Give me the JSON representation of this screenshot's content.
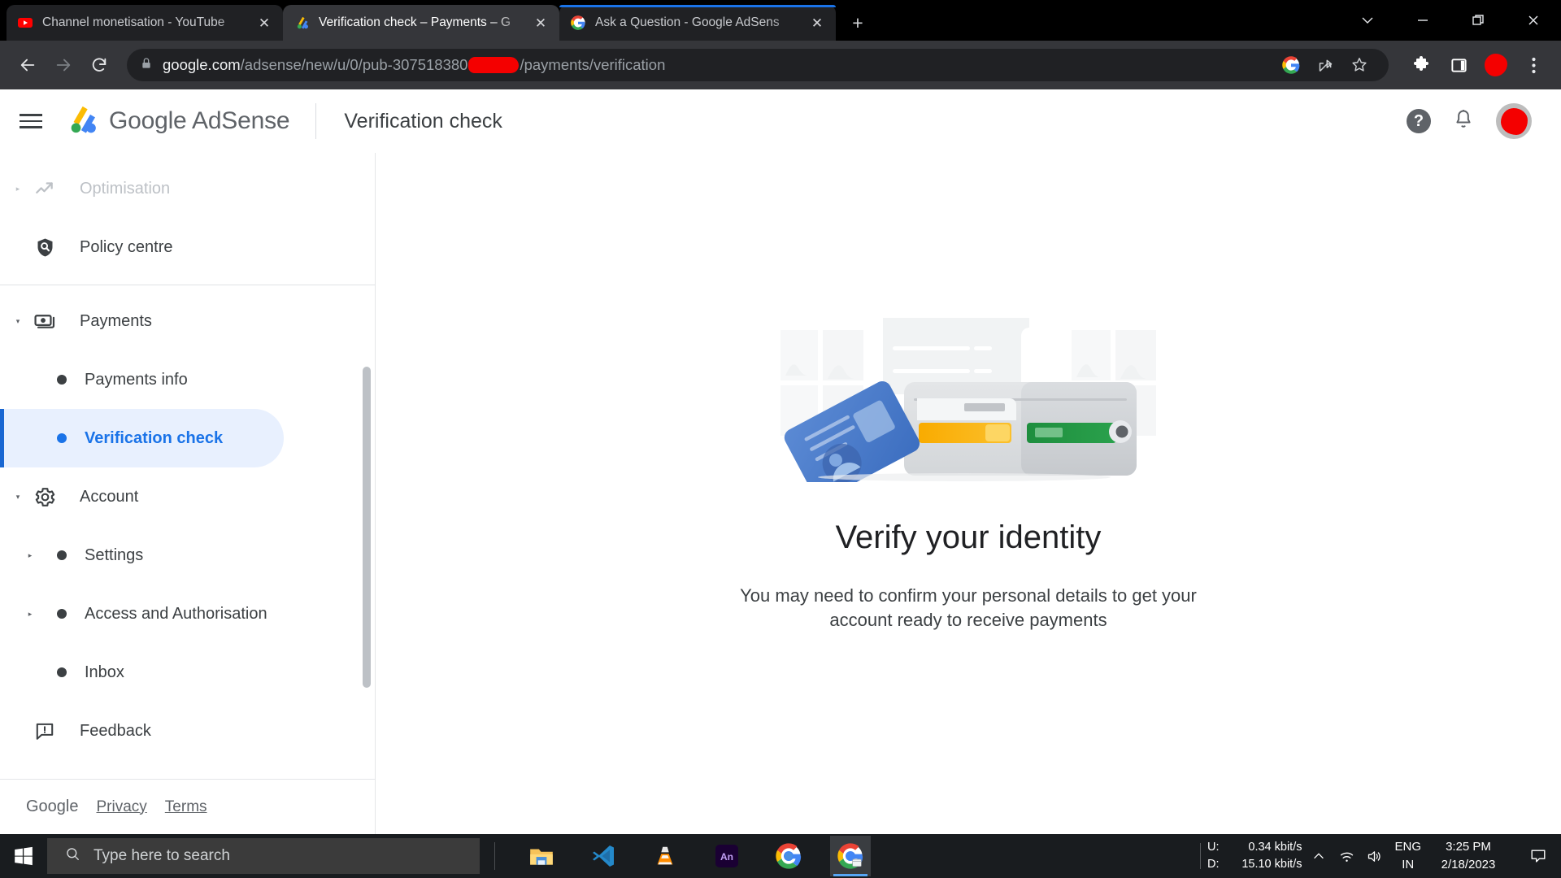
{
  "browser": {
    "tabs": [
      {
        "title": "Channel monetisation - YouTube",
        "favicon": "youtube-icon",
        "active": false,
        "close_label": "✕"
      },
      {
        "title": "Verification check – Payments – G",
        "favicon": "adsense-icon",
        "active": true,
        "close_label": "✕"
      },
      {
        "title": "Ask a Question - Google AdSens",
        "favicon": "google-icon",
        "active": false,
        "close_label": "✕"
      }
    ],
    "new_tab_label": "+",
    "window_controls": {
      "tab_search": "⌄",
      "minimize": "—",
      "maximize": "❐",
      "close": "✕"
    },
    "omnibox": {
      "lock_icon": "lock-icon",
      "url_host": "google.com",
      "url_path_before": "/adsense/new/u/0/pub-307518380",
      "url_redacted": true,
      "url_path_after": "/payments/verification"
    },
    "toolbar_icons": [
      "google-icon",
      "share-icon",
      "bookmark-star-icon",
      "extensions-puzzle-icon",
      "side-panel-icon",
      "profile-avatar-icon",
      "three-dot-menu-icon"
    ]
  },
  "adsense": {
    "menu_label": "Main menu",
    "brand": "Google AdSense",
    "page_title": "Verification check",
    "header_icons": {
      "help": "?",
      "notifications": "bell-icon",
      "account": "avatar"
    }
  },
  "sidebar": {
    "items": [
      {
        "label": "Optimisation",
        "icon": "trending-up-icon",
        "type": "group",
        "expandable": true,
        "expanded": false,
        "dim": true
      },
      {
        "label": "Policy centre",
        "icon": "shield-search-icon",
        "type": "group",
        "expandable": false,
        "dim": false
      },
      {
        "label": "Payments",
        "icon": "payments-icon",
        "type": "group",
        "expandable": true,
        "expanded": true,
        "dim": false
      },
      {
        "label": "Payments info",
        "type": "sub",
        "selected": false,
        "expandable": false
      },
      {
        "label": "Verification check",
        "type": "sub",
        "selected": true,
        "expandable": false
      },
      {
        "label": "Account",
        "icon": "gear-icon",
        "type": "group",
        "expandable": true,
        "expanded": true,
        "dim": false
      },
      {
        "label": "Settings",
        "type": "sub",
        "selected": false,
        "expandable": true
      },
      {
        "label": "Access and Authorisation",
        "type": "sub",
        "selected": false,
        "expandable": true
      },
      {
        "label": "Inbox",
        "type": "sub",
        "selected": false,
        "expandable": false
      },
      {
        "label": "Feedback",
        "icon": "feedback-icon",
        "type": "group",
        "expandable": false,
        "dim": false
      }
    ],
    "footer": {
      "google": "Google",
      "privacy": "Privacy",
      "terms": "Terms"
    }
  },
  "main": {
    "illustration": "identity-verification-wallet-illustration",
    "title": "Verify your identity",
    "subtitle": "You may need to confirm your personal details to get your account ready to receive payments"
  },
  "taskbar": {
    "start": "windows-start-icon",
    "search_placeholder": "Type here to search",
    "apps": [
      {
        "name": "file-explorer",
        "active": false
      },
      {
        "name": "visual-studio-code",
        "active": false
      },
      {
        "name": "vlc-media-player",
        "active": false
      },
      {
        "name": "adobe-animate",
        "label": "An",
        "active": false
      },
      {
        "name": "google-chrome",
        "active": false
      },
      {
        "name": "google-chrome-window",
        "active": true
      }
    ],
    "tray": {
      "upload_label": "U:",
      "download_label": "D:",
      "upload_speed": "0.34 kbit/s",
      "download_speed": "15.10 kbit/s",
      "chevron": "⌃",
      "language_top": "ENG",
      "language_bottom": "IN",
      "time": "3:25 PM",
      "date": "2/18/2023"
    }
  },
  "colors": {
    "accent_blue": "#1a73e8",
    "selected_bg": "#e8f0fe",
    "redaction_red": "#f40000",
    "chrome_dark": "#35363a",
    "taskbar": "#191c1f"
  }
}
